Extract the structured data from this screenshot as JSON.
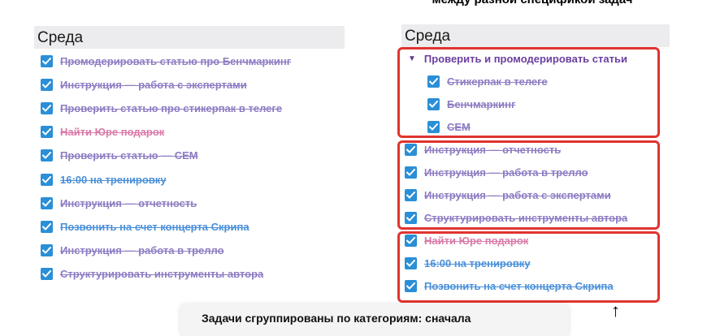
{
  "top_caption": "между разной спецификой задач",
  "colors": {
    "purple": "#8e7cc3",
    "blue": "#4a90d9",
    "pink": "#d97aa8",
    "checkbox": "#2a8fd6",
    "group_border": "#e0342f"
  },
  "left": {
    "header": "Среда",
    "items": [
      {
        "label": "Промодерировать статью про Бенчмаркинг",
        "color": "#8e7cc3"
      },
      {
        "label": "Инструкция — работа с экспертами",
        "color": "#8e7cc3"
      },
      {
        "label": "Проверить статью про стикерпак в телеге",
        "color": "#8e7cc3"
      },
      {
        "label": "Найти Юре подарок",
        "color": "#d97aa8"
      },
      {
        "label": "Проверить статью — CEM",
        "color": "#8e7cc3"
      },
      {
        "label": "16:00 на тренировку",
        "color": "#4a90d9"
      },
      {
        "label": "Инструкция — отчетность",
        "color": "#8e7cc3"
      },
      {
        "label": "Позвонить на счет концерта Скрипа",
        "color": "#4a90d9"
      },
      {
        "label": "Инструкция — работа в трелло",
        "color": "#8e7cc3"
      },
      {
        "label": "Структурировать инструменты автора",
        "color": "#8e7cc3"
      }
    ]
  },
  "right": {
    "header": "Среда",
    "parent": {
      "label": "Проверить и промодерировать статьи",
      "icon": "triangle-down-icon"
    },
    "subitems": [
      {
        "label": "Стикерпак в телеге",
        "color": "#8e7cc3"
      },
      {
        "label": "Бенчмаркинг",
        "color": "#8e7cc3"
      },
      {
        "label": "CEM",
        "color": "#8e7cc3"
      }
    ],
    "group2": [
      {
        "label": "Инструкция — отчетность",
        "color": "#8e7cc3"
      },
      {
        "label": "Инструкция — работа в трелло",
        "color": "#8e7cc3"
      },
      {
        "label": "Инструкция — работа с экспертами",
        "color": "#8e7cc3"
      },
      {
        "label": "Структурировать инструменты автора",
        "color": "#8e7cc3"
      }
    ],
    "group3": [
      {
        "label": "Найти Юре подарок",
        "color": "#d97aa8"
      },
      {
        "label": "16:00 на тренировку",
        "color": "#4a90d9"
      },
      {
        "label": "Позвонить на счет концерта Скрипа",
        "color": "#4a90d9"
      }
    ]
  },
  "bottom_note": "Задачи сгруппированы по категориям: сначала",
  "arrow_icon": "arrow-up-icon"
}
